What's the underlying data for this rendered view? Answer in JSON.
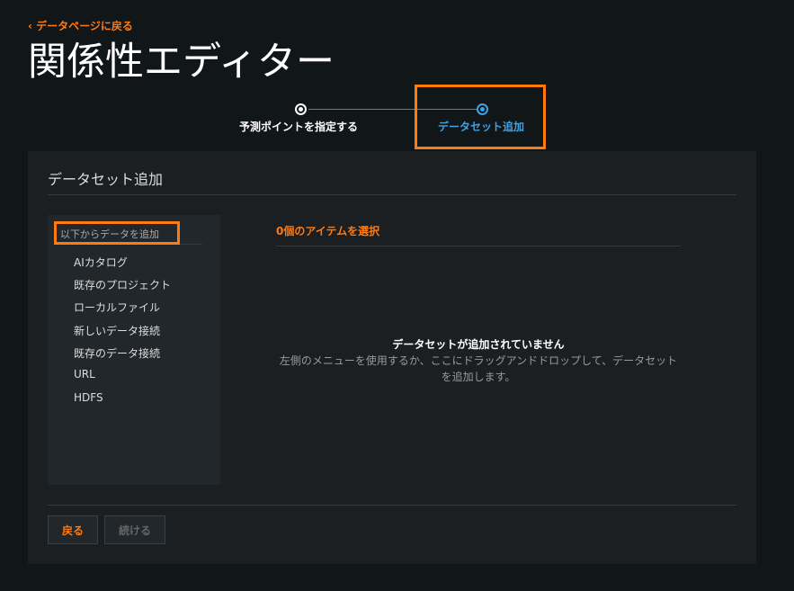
{
  "header": {
    "back_link": "‹ データページに戻る",
    "title": "関係性エディター"
  },
  "stepper": {
    "steps": [
      {
        "label": "予測ポイントを指定する"
      },
      {
        "label": "データセット追加"
      }
    ]
  },
  "panel": {
    "title": "データセット追加",
    "sidebar": {
      "heading": "以下からデータを追加",
      "items": [
        "AIカタログ",
        "既存のプロジェクト",
        "ローカルファイル",
        "新しいデータ接続",
        "既存のデータ接続",
        "URL",
        "HDFS"
      ]
    },
    "selection": "0個のアイテムを選択",
    "empty_title": "データセットが追加されていません",
    "empty_desc": "左側のメニューを使用するか、ここにドラッグアンドドロップして、データセットを追加します。",
    "back_button": "戻る",
    "continue_button": "続ける"
  }
}
